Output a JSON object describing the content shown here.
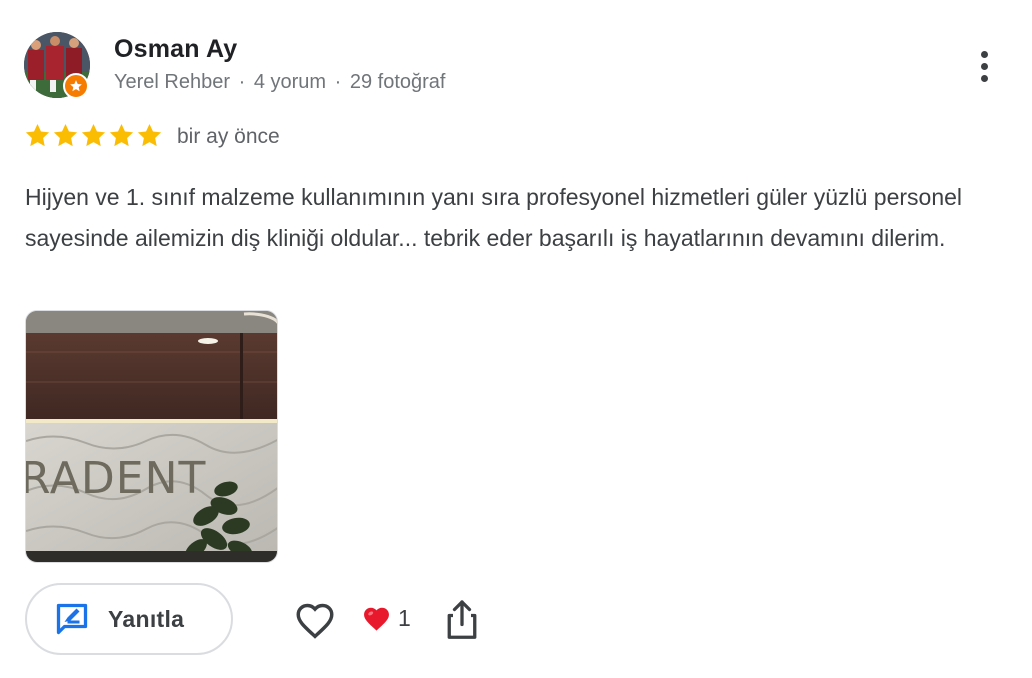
{
  "reviewer": {
    "name": "Osman Ay",
    "badge": "Yerel Rehber",
    "separator": "·",
    "reviews_count": "4 yorum",
    "photos_count": "29 fotoğraf",
    "avatar_icon": "avatar-photo",
    "badge_icon": "local-guide-star-icon"
  },
  "rating": {
    "stars": 5,
    "max": 5,
    "star_color": "#fbbc04"
  },
  "review": {
    "date": "bir ay önce",
    "text": "Hijyen ve 1. sınıf malzeme kullanımının yanı sıra profesyonel hizmetleri güler yüzlü personel sayesinde ailemizin diş kliniği oldular... tebrik eder başarılı iş hayatlarının devamını dilerim.",
    "photo": {
      "sign_text": "RADENT"
    }
  },
  "actions": {
    "reply_label": "Yanıtla",
    "reply_icon": "reply-edit-icon",
    "like_icon": "heart-outline-icon",
    "reaction_icon": "red-heart-icon",
    "reaction_count": "1",
    "share_icon": "share-icon",
    "more_icon": "more-vertical-icon"
  },
  "colors": {
    "accent_blue": "#1a73e8",
    "guide_orange": "#f57c00",
    "heart_red": "#e8192c"
  }
}
